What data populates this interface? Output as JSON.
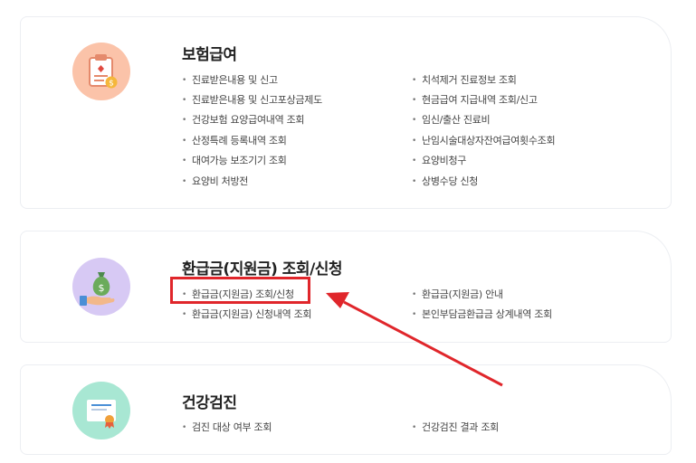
{
  "sections": [
    {
      "title": "보험급여",
      "icon": "clipboard-icon",
      "icon_bg": "#fbc3a9",
      "items_col1": [
        "진료받은내용 및 신고",
        "진료받은내용 및 신고포상금제도",
        "건강보험 요양급여내역 조회",
        "산정특례 등록내역 조회",
        "대여가능 보조기기 조회",
        "요양비 처방전"
      ],
      "items_col2": [
        "치석제거 진료정보 조회",
        "현금급여 지급내역 조회/신고",
        "임신/출산 진료비",
        "난임시술대상자잔여급여횟수조회",
        "요양비청구",
        "상병수당 신청"
      ]
    },
    {
      "title": "환급금(지원금) 조회/신청",
      "icon": "money-bag-hand-icon",
      "icon_bg": "#d7c9f4",
      "items_col1": [
        "환급금(지원금) 조회/신청",
        "환급금(지원금) 신청내역 조회"
      ],
      "items_col2": [
        "환급금(지원금) 안내",
        "본인부담금환급금 상계내역 조회"
      ]
    },
    {
      "title": "건강검진",
      "icon": "certificate-icon",
      "icon_bg": "#a8e7d3",
      "items_col1": [
        "검진 대상 여부 조회"
      ],
      "items_col2": [
        "건강검진 결과 조회"
      ]
    }
  ],
  "annotation": {
    "color": "#e0262b"
  }
}
